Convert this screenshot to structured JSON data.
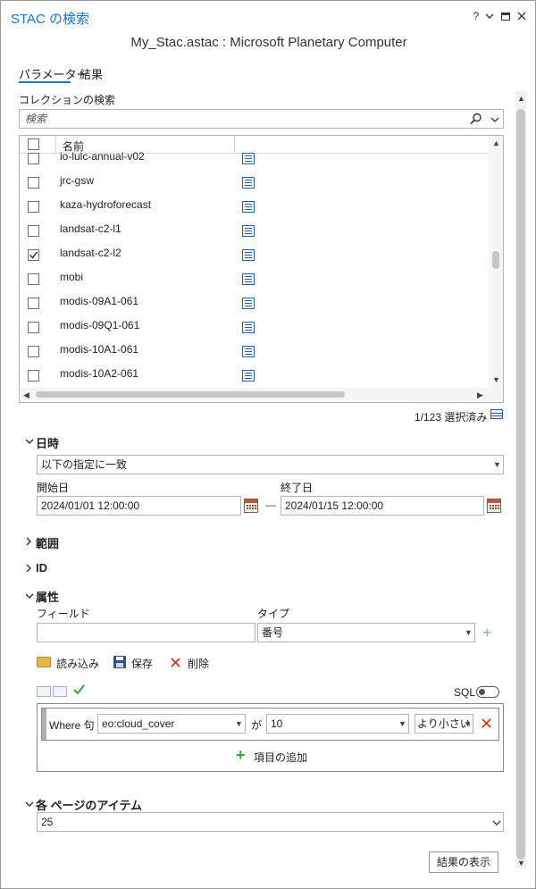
{
  "window": {
    "title": "STAC の検索",
    "help": "?",
    "subtitle": "My_Stac.astac : Microsoft Planetary Computer"
  },
  "tabs": [
    {
      "label": "パラメーター",
      "active": true
    },
    {
      "label": "結果",
      "active": false
    }
  ],
  "collection_search": {
    "label": "コレクションの検索",
    "placeholder": "検索",
    "column_header": "名前",
    "rows": [
      {
        "name": "io-lulc-annual-v02",
        "checked": false
      },
      {
        "name": "jrc-gsw",
        "checked": false
      },
      {
        "name": "kaza-hydroforecast",
        "checked": false
      },
      {
        "name": "landsat-c2-l1",
        "checked": false
      },
      {
        "name": "landsat-c2-l2",
        "checked": true
      },
      {
        "name": "mobi",
        "checked": false
      },
      {
        "name": "modis-09A1-061",
        "checked": false
      },
      {
        "name": "modis-09Q1-061",
        "checked": false
      },
      {
        "name": "modis-10A1-061",
        "checked": false
      },
      {
        "name": "modis-10A2-061",
        "checked": false
      }
    ],
    "selection_count": "1/123 選択済み"
  },
  "datetime": {
    "header": "日時",
    "mode": "以下の指定に一致",
    "start_label": "開始日",
    "start_value": "2024/01/01 12:00:00",
    "end_label": "終了日",
    "end_value": "2024/01/15 12:00:00",
    "separator": "—"
  },
  "extent": {
    "header": "範囲"
  },
  "id_section": {
    "header": "ID"
  },
  "properties": {
    "header": "属性",
    "field_label": "フィールド",
    "field_value": "",
    "type_label": "タイプ",
    "type_value": "番号",
    "load_label": "読み込み",
    "save_label": "保存",
    "delete_label": "削除",
    "sql_label": "SQL",
    "where_label": "Where 句",
    "where_field": "eo:cloud_cover",
    "where_connector": "が",
    "where_value": "10",
    "where_operator": "より小さい",
    "add_clause_label": "項目の追加"
  },
  "items_per_page": {
    "header": "各 ページのアイテム",
    "value": "25"
  },
  "show_results_label": "結果の表示",
  "colors": {
    "accent": "#1a73c8",
    "delete": "#d0391f",
    "add": "#3aa640"
  }
}
